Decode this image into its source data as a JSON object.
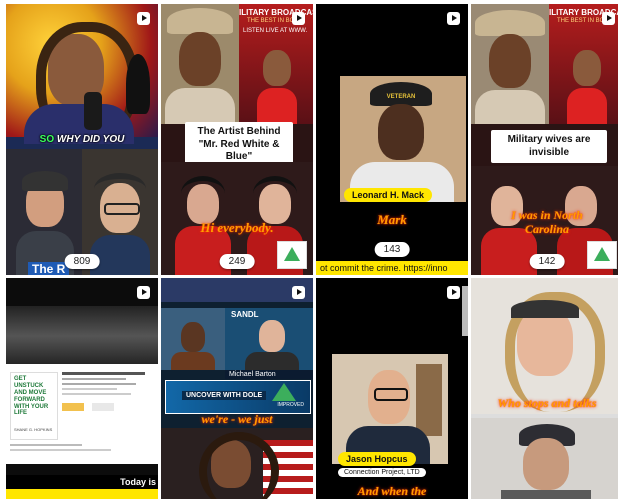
{
  "tiles": [
    {
      "id": "t1",
      "caption_top": "SO",
      "caption_rest": "WHY DID YOU",
      "views": "809",
      "bottom_text": "The R"
    },
    {
      "id": "t2",
      "header": "ILITARY BROADCAST N",
      "header_sub": "THE BEST IN BO",
      "header_sub2": "LISTEN LIVE AT WWW.",
      "banner": "The Artist Behind \"Mr. Red White & Blue\"",
      "caption": "Hi everybody.",
      "views": "249"
    },
    {
      "id": "t3",
      "hat_text": "VETERAN",
      "name": "Leonard H. Mack",
      "caption": "Mark",
      "views": "143",
      "ticker": "ot commit the crime. https://inno"
    },
    {
      "id": "t4",
      "header": "ILITARY BROADCAST N",
      "header_sub": "THE BEST IN BO",
      "banner": "Military wives are invisible",
      "caption": "I was in North Carolina",
      "views": "142"
    },
    {
      "id": "t5",
      "doc_title": "GET UNSTUCK AND MOVE FORWARD WITH YOUR LIFE",
      "doc_author": "SHANE G. HOPKINS",
      "ticker": "Today is"
    },
    {
      "id": "t6",
      "lower_name": "Michael Barton",
      "banner_text": "UNCOVER WITH DOLE",
      "banner_logo": "IMPROVED",
      "caption": "we're - we just",
      "header_item": "SANDL"
    },
    {
      "id": "t7",
      "name": "Jason Hopcus",
      "subtitle": "Connection Project, LTD",
      "caption": "And when the"
    },
    {
      "id": "t8",
      "caption": "Who stops and talks"
    }
  ]
}
